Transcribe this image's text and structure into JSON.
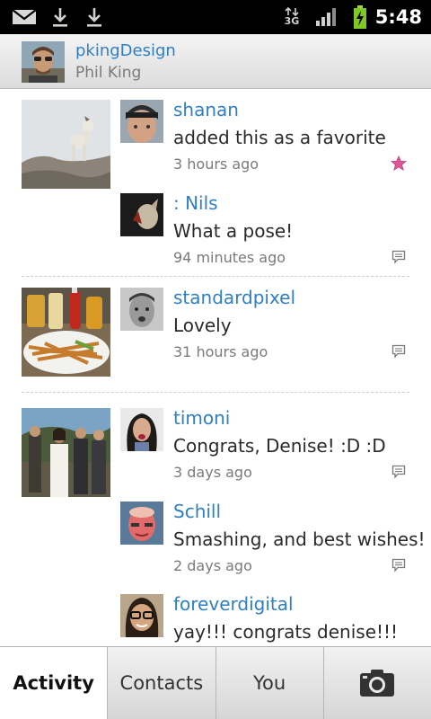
{
  "status_bar": {
    "time": "5:48",
    "network": "3G",
    "icons": [
      "gmail-icon",
      "download-icon",
      "download-icon",
      "network-3g-icon",
      "signal-icon",
      "battery-charging-icon"
    ]
  },
  "header": {
    "username": "pkingDesign",
    "real_name": "Phil King"
  },
  "feed": [
    {
      "photo": "dog-on-rock-photo",
      "comments": [
        {
          "name": "shanan",
          "text": "added this as a favorite",
          "time": "3 hours ago",
          "badge": "favorite-star-icon"
        },
        {
          "name": ": Nils",
          "text": "What a pose!",
          "time": "94 minutes ago",
          "badge": "comment-icon"
        }
      ]
    },
    {
      "photo": "fries-and-sauces-photo",
      "comments": [
        {
          "name": "standardpixel",
          "text": "Lovely",
          "time": "31 hours ago",
          "badge": "comment-icon"
        }
      ]
    },
    {
      "photo": "wedding-group-photo",
      "comments": [
        {
          "name": "timoni",
          "text": "Congrats, Denise! :D :D",
          "time": "3 days ago",
          "badge": "comment-icon"
        },
        {
          "name": "Schill",
          "text": "Smashing, and best wishes!",
          "time": "2 days ago",
          "badge": "comment-icon"
        },
        {
          "name": "foreverdigital",
          "text": "yay!!! congrats denise!!!",
          "time": "",
          "badge": ""
        }
      ]
    }
  ],
  "tabs": [
    {
      "label": "Activity",
      "active": true
    },
    {
      "label": "Contacts",
      "active": false
    },
    {
      "label": "You",
      "active": false
    },
    {
      "label": "",
      "icon": "camera-icon",
      "active": false
    }
  ],
  "colors": {
    "link": "#2f7fc4",
    "text": "#2a2a2a",
    "muted": "#7a7a7a",
    "favorite": "#e0559a"
  }
}
